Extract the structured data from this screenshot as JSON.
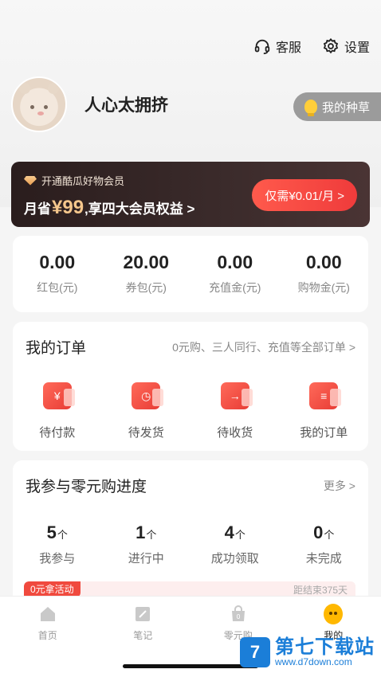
{
  "header": {
    "service_label": "客服",
    "settings_label": "设置"
  },
  "profile": {
    "username": "人心太拥挤",
    "grass_label": "我的种草"
  },
  "vip": {
    "title": "开通酷瓜好物会员",
    "desc_prefix": "月省",
    "price": "¥99",
    "desc_suffix": ",享四大会员权益 >",
    "button_label": "仅需¥0.01/月 >"
  },
  "wallet": [
    {
      "value": "0.00",
      "label": "红包(元)"
    },
    {
      "value": "20.00",
      "label": "券包(元)"
    },
    {
      "value": "0.00",
      "label": "充值金(元)"
    },
    {
      "value": "0.00",
      "label": "购物金(元)"
    }
  ],
  "orders": {
    "title": "我的订单",
    "link": "0元购、三人同行、充值等全部订单 >",
    "items": [
      {
        "label": "待付款",
        "glyph": "¥",
        "icon": "wallet-icon"
      },
      {
        "label": "待发货",
        "glyph": "◷",
        "icon": "clock-icon"
      },
      {
        "label": "待收货",
        "glyph": "→",
        "icon": "delivery-icon"
      },
      {
        "label": "我的订单",
        "glyph": "≡",
        "icon": "order-list-icon"
      }
    ]
  },
  "progress": {
    "title": "我参与零元购进度",
    "more": "更多 >",
    "unit": "个",
    "items": [
      {
        "value": "5",
        "label": "我参与"
      },
      {
        "value": "1",
        "label": "进行中"
      },
      {
        "value": "4",
        "label": "成功领取"
      },
      {
        "value": "0",
        "label": "未完成"
      }
    ],
    "zero_tag": "0元拿活动",
    "zero_count": "距结束375天"
  },
  "tabbar": [
    {
      "label": "首页",
      "icon": "home-icon",
      "active": false
    },
    {
      "label": "笔记",
      "icon": "note-icon",
      "active": false
    },
    {
      "label": "零元购",
      "icon": "zero-buy-icon",
      "active": false
    },
    {
      "label": "我的",
      "icon": "me-icon",
      "active": true
    }
  ],
  "watermark": {
    "logo": "7",
    "title": "第七下载站",
    "url": "www.d7down.com"
  },
  "colors": {
    "accent_red": "#ef3b3b",
    "vip_gold": "#f5c78c",
    "vip_bg": "#2a1d1d",
    "watermark_blue": "#1b7ed8"
  }
}
